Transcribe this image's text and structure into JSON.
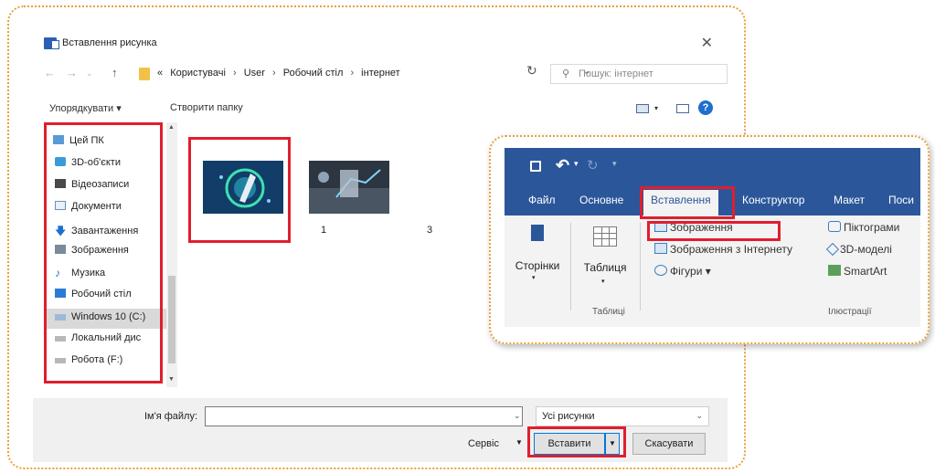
{
  "dialog": {
    "title": "Вставлення рисунка",
    "close": "✕",
    "nav": {
      "back": "←",
      "forward": "→",
      "up": "↑"
    },
    "breadcrumb": {
      "prefix": "«",
      "parts": [
        "Користувачі",
        "User",
        "Робочий стіл",
        "інтернет"
      ],
      "sep": "›"
    },
    "refresh": "↻",
    "search_placeholder": "Пошук: інтернет",
    "toolbar": {
      "organize": "Упорядкувати ▾",
      "new_folder": "Створити папку"
    },
    "help": "?",
    "nav_items": [
      {
        "label": "Цей ПК",
        "icon": "pc-icon"
      },
      {
        "label": "3D-об'єкти",
        "icon": "cube-icon"
      },
      {
        "label": "Відеозаписи",
        "icon": "video-icon"
      },
      {
        "label": "Документи",
        "icon": "document-icon"
      },
      {
        "label": "Завантаження",
        "icon": "download-icon"
      },
      {
        "label": "Зображення",
        "icon": "picture-icon"
      },
      {
        "label": "Музика",
        "icon": "music-icon"
      },
      {
        "label": "Робочий стіл",
        "icon": "desktop-icon"
      },
      {
        "label": "Windows 10 (C:)",
        "icon": "drive-icon"
      },
      {
        "label": "Локальний дис",
        "icon": "drive-icon"
      },
      {
        "label": "Робота (F:)",
        "icon": "drive-icon"
      }
    ],
    "files": [
      {
        "name": "1"
      },
      {
        "name": "3"
      }
    ],
    "filename_label": "Ім'я файлу:",
    "filename_value": "",
    "filter": "Усі рисунки",
    "service": "Сервіс",
    "insert": "Вставити",
    "cancel": "Скасувати"
  },
  "ribbon": {
    "tabs": [
      "Файл",
      "Основне",
      "Вставлення",
      "Конструктор",
      "Макет",
      "Поси"
    ],
    "active_tab": "Вставлення",
    "pages_label": "Сторінки",
    "table_label": "Таблиця",
    "tables_group": "Таблиці",
    "pictures": "Зображення",
    "online_pictures": "Зображення з Інтернету",
    "shapes": "Фігури ▾",
    "icons": "Піктограми",
    "models": "3D-моделі",
    "smartart": "SmartArt",
    "illustrations_group": "Ілюстрації"
  },
  "colors": {
    "highlight": "#e01e2d",
    "card_border": "#e8a13a",
    "ribbon_blue": "#2b579a"
  }
}
